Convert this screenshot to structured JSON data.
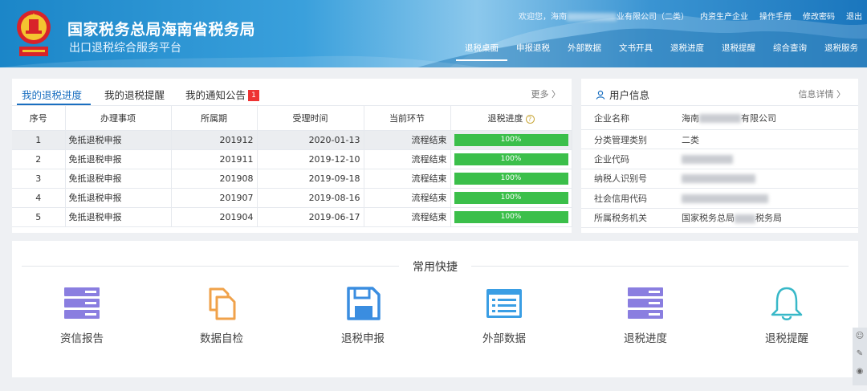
{
  "header": {
    "title": "国家税务总局海南省税务局",
    "subtitle": "出口退税综合服务平台",
    "greeting": "欢迎您，海南",
    "company_suffix": "业有限公司（二类）",
    "top_links": [
      "内资生产企业",
      "操作手册",
      "修改密码",
      "退出"
    ],
    "nav": [
      "退税桌面",
      "申报退税",
      "外部数据",
      "文书开具",
      "退税进度",
      "退税提醒",
      "综合查询",
      "退税服务"
    ],
    "active_nav": "退税桌面"
  },
  "progress": {
    "tabs": [
      "我的退税进度",
      "我的退税提醒",
      "我的通知公告"
    ],
    "notice_badge": "1",
    "more": "更多 〉",
    "columns": [
      "序号",
      "办理事项",
      "所属期",
      "受理时间",
      "当前环节",
      "退税进度"
    ],
    "rows": [
      {
        "no": "1",
        "item": "免抵退税申报",
        "period": "201912",
        "time": "2020-01-13",
        "stage": "流程结束",
        "progress": "100%"
      },
      {
        "no": "2",
        "item": "免抵退税申报",
        "period": "201911",
        "time": "2019-12-10",
        "stage": "流程结束",
        "progress": "100%"
      },
      {
        "no": "3",
        "item": "免抵退税申报",
        "period": "201908",
        "time": "2019-09-18",
        "stage": "流程结束",
        "progress": "100%"
      },
      {
        "no": "4",
        "item": "免抵退税申报",
        "period": "201907",
        "time": "2019-08-16",
        "stage": "流程结束",
        "progress": "100%"
      },
      {
        "no": "5",
        "item": "免抵退税申报",
        "period": "201904",
        "time": "2019-06-17",
        "stage": "流程结束",
        "progress": "100%"
      }
    ]
  },
  "user_info": {
    "title": "用户信息",
    "detail": "信息详情 〉",
    "rows": [
      {
        "label": "企业名称",
        "prefix": "海南",
        "suffix": "有限公司"
      },
      {
        "label": "分类管理类别",
        "prefix": "二类",
        "suffix": ""
      },
      {
        "label": "企业代码",
        "prefix": "",
        "suffix": ""
      },
      {
        "label": "纳税人识别号",
        "prefix": "",
        "suffix": ""
      },
      {
        "label": "社会信用代码",
        "prefix": "",
        "suffix": ""
      },
      {
        "label": "所属税务机关",
        "prefix": "国家税务总局",
        "suffix": "税务局"
      }
    ]
  },
  "shortcuts": {
    "title": "常用快捷",
    "items": [
      {
        "label": "资信报告",
        "icon": "server-stack-icon",
        "color": "#8a7ee0"
      },
      {
        "label": "数据自检",
        "icon": "copy-document-icon",
        "color": "#f0a24a"
      },
      {
        "label": "退税申报",
        "icon": "floppy-disk-icon",
        "color": "#3a8de0"
      },
      {
        "label": "外部数据",
        "icon": "list-window-icon",
        "color": "#3a9ee4"
      },
      {
        "label": "退税进度",
        "icon": "server-stack-icon",
        "color": "#8a7ee0"
      },
      {
        "label": "退税提醒",
        "icon": "bell-icon",
        "color": "#38b8c8"
      }
    ]
  },
  "colors": {
    "accent": "#1a6fc0",
    "progress_bar": "#3bbf4a",
    "header": "#1b86c8",
    "badge": "#e33333"
  }
}
